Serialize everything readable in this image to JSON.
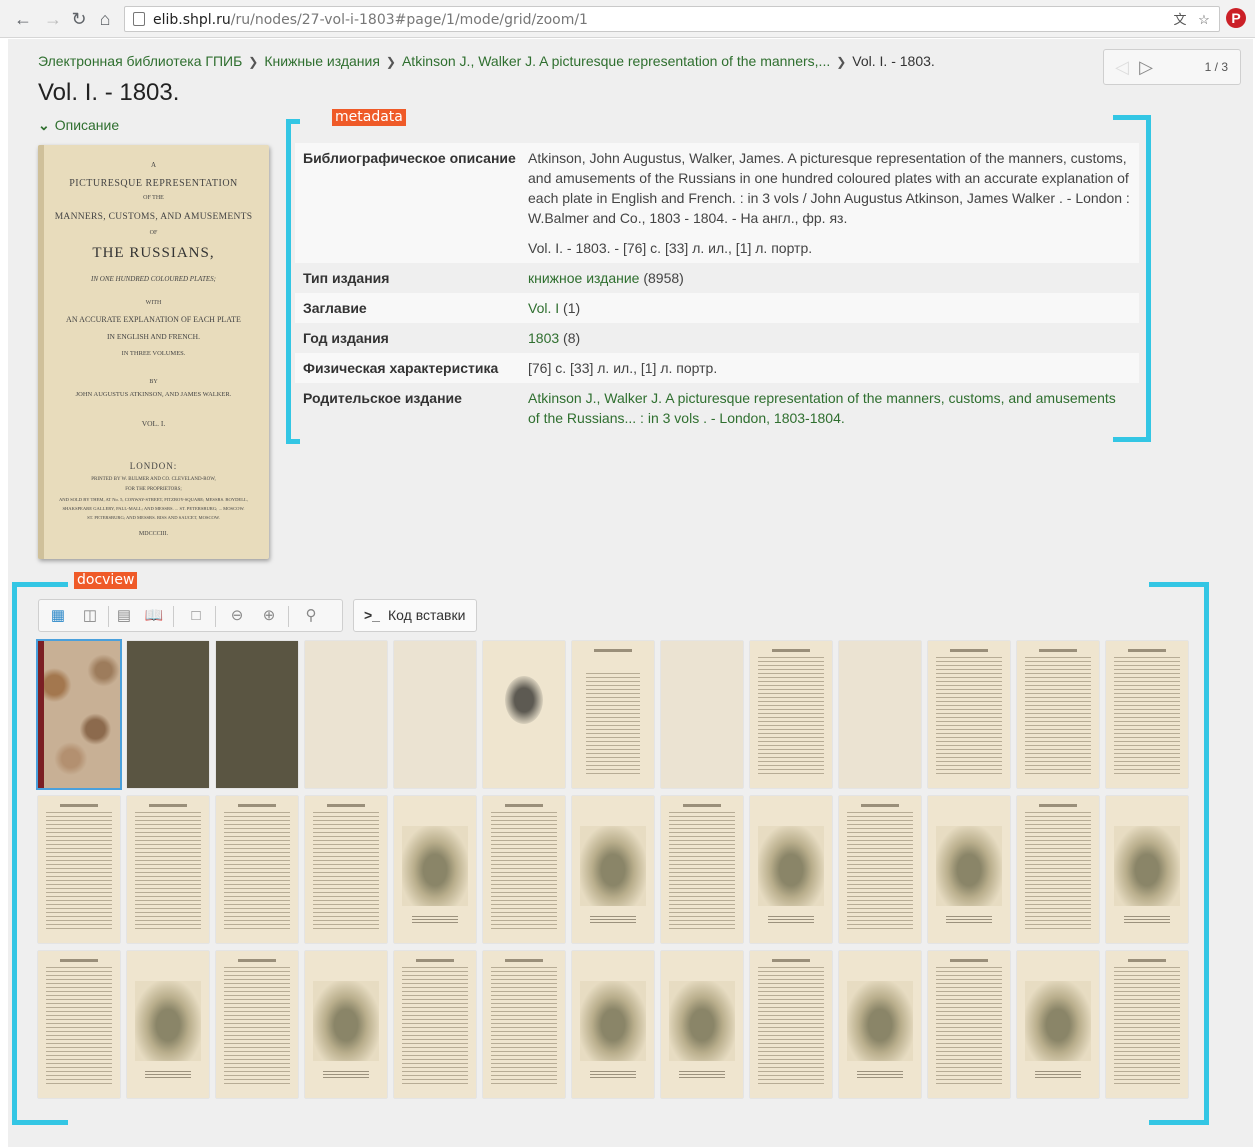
{
  "browser": {
    "url_host": "elib.shpl.ru",
    "url_path": "/ru/nodes/27-vol-i-1803#page/1/mode/grid/zoom/1"
  },
  "breadcrumb": [
    "Электронная библиотека ГПИБ",
    "Книжные издания",
    "Atkinson J., Walker J. A picturesque representation of the manners,...",
    "Vol. I. - 1803."
  ],
  "pager": {
    "count": "1 / 3"
  },
  "page_title": "Vol. I. - 1803.",
  "description_toggle": "Описание",
  "annotations": {
    "metadata": "metadata",
    "docview": "docview"
  },
  "cover": {
    "lines": [
      "A",
      "PICTURESQUE REPRESENTATION",
      "OF THE",
      "MANNERS, CUSTOMS, AND AMUSEMENTS",
      "OF",
      "THE RUSSIANS,",
      "IN ONE HUNDRED COLOURED PLATES;",
      "WITH",
      "AN ACCURATE EXPLANATION OF EACH PLATE",
      "IN ENGLISH AND FRENCH.",
      "IN THREE VOLUMES.",
      "BY",
      "JOHN AUGUSTUS ATKINSON, AND JAMES WALKER.",
      "VOL. I.",
      "LONDON:",
      "PRINTED BY W. BULMER AND CO. CLEVELAND-ROW,",
      "FOR THE PROPRIETORS;",
      "AND SOLD BY THEM, AT No. 5, CONWAY-STREET, FITZROY-SQUARE; MESSRS. BOYDELL,",
      "SHAKSPEARE GALLERY, PALL-MALL; AND MESSRS. ... ST. PETERSBURG; ... MOSCOW.",
      "ST. PETERSBURG; AND MESSRS. RISS AND SAUCET, MOSCOW.",
      "MDCCCIII."
    ]
  },
  "metadata": {
    "rows": [
      {
        "key": "Библиографическое описание",
        "value": "Atkinson, John Augustus, Walker, James. A picturesque representation of the manners, customs, and amusements of the Russians in one hundred coloured plates with an accurate explanation of each plate in English and French. : in 3 vols / John Augustus Atkinson, James Walker . - London : W.Balmer and Co., 1803 - 1804. - На англ., фр. яз.",
        "value2": "Vol. I. - 1803. - [76] с. [33] л. ил., [1] л. портр."
      },
      {
        "key": "Тип издания",
        "link": "книжное издание",
        "suffix": " (8958)"
      },
      {
        "key": "Заглавие",
        "link": "Vol. I",
        "suffix": " (1)"
      },
      {
        "key": "Год издания",
        "link": "1803",
        "suffix": " (8)"
      },
      {
        "key": "Физическая характеристика",
        "value": "[76] с. [33] л. ил., [1] л. портр."
      },
      {
        "key": "Родительское издание",
        "link": "Atkinson J., Walker J. A picturesque representation of the manners, customs, and amusements of the Russians... : in 3 vols . - London, 1803-1804."
      }
    ]
  },
  "docview": {
    "embed_label": "Код вставки",
    "toolbar": [
      "grid-large-icon",
      "grid-small-icon",
      "single-page-icon",
      "two-page-icon",
      "fullscreen-icon",
      "zoom-out-icon",
      "zoom-in-icon",
      "search-icon"
    ],
    "thumbs": [
      [
        "marble",
        "dark",
        "dark",
        "blank",
        "blank",
        "portrait",
        "title",
        "blank",
        "text",
        "blank",
        "text",
        "text",
        "text"
      ],
      [
        "text",
        "text",
        "text",
        "text",
        "plate",
        "text",
        "plate",
        "text",
        "plate",
        "text",
        "plate",
        "text",
        "plate"
      ],
      [
        "text",
        "plate",
        "text",
        "plate",
        "text",
        "text",
        "plate",
        "plate",
        "text",
        "plate",
        "text",
        "plate",
        "text"
      ]
    ],
    "selected_index": 0
  },
  "colors": {
    "link": "#2f6f2f",
    "annotation_tag": "#ef5a28",
    "annotation_bracket": "#33c6e4",
    "toolbar_active": "#2a87c8"
  }
}
